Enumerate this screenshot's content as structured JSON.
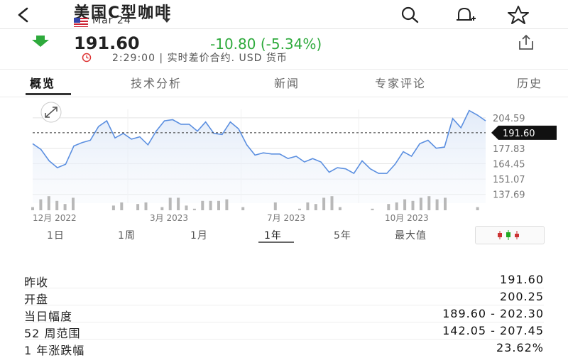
{
  "header": {
    "title": "美国C型咖啡",
    "subtitle": "Mar 24"
  },
  "quote": {
    "price": "191.60",
    "change": "-10.80 (-5.34%)",
    "status": "2:29:00 | 实时差价合约.  USD 货币",
    "change_color": "#2eaa3c"
  },
  "tabs": [
    {
      "label": "概览"
    },
    {
      "label": "技术分析"
    },
    {
      "label": "新闻"
    },
    {
      "label": "专家评论"
    },
    {
      "label": "历史"
    }
  ],
  "chart_data": {
    "type": "line",
    "y_ticks": [
      "204.59",
      "191.60",
      "177.83",
      "164.45",
      "151.07",
      "137.69"
    ],
    "current_label": "191.60",
    "x_ticks": [
      "12月 2022",
      "3月 2023",
      "7月 2023",
      "10月 2023"
    ],
    "ylim": [
      130,
      212
    ],
    "series": [
      {
        "values": [
          182,
          177,
          167,
          161,
          164,
          180,
          183,
          185,
          197,
          202,
          187,
          191,
          186,
          188,
          181,
          193,
          202,
          203,
          199,
          199,
          193,
          201,
          191,
          190,
          201,
          195,
          181,
          172,
          174,
          173,
          173,
          169,
          171,
          166,
          169,
          166,
          157,
          161,
          160,
          156,
          167,
          160,
          156,
          156,
          164,
          175,
          171,
          182,
          185,
          178,
          179,
          204,
          196,
          211,
          207,
          202
        ]
      }
    ],
    "volume": [
      2,
      7,
      9,
      6,
      4,
      8,
      0,
      0,
      0,
      0,
      3,
      5,
      0,
      4,
      5,
      0,
      2,
      8,
      8,
      3,
      1,
      6,
      6,
      6,
      7,
      0,
      2,
      0,
      0,
      0,
      5,
      0,
      0,
      1,
      5,
      4,
      8,
      9,
      2,
      0,
      0,
      0,
      1,
      0,
      4,
      5,
      7,
      6,
      8,
      9,
      7,
      8,
      0,
      0,
      0,
      2,
      0
    ],
    "grid": true,
    "line_color": "#5b8fe0"
  },
  "ranges": [
    {
      "label": "1日"
    },
    {
      "label": "1周"
    },
    {
      "label": "1月"
    },
    {
      "label": "1年"
    },
    {
      "label": "5年"
    },
    {
      "label": "最大值"
    }
  ],
  "stats": [
    {
      "label": "昨收",
      "value": "191.60"
    },
    {
      "label": "开盘",
      "value": "200.25"
    },
    {
      "label": "当日幅度",
      "value": "189.60 - 202.30"
    },
    {
      "label": "52 周范围",
      "value": "142.05 - 207.45"
    },
    {
      "label": "1 年涨跌幅",
      "value": "23.62%"
    }
  ],
  "icons": {
    "back": "chevron-left-icon",
    "search": "search-icon",
    "alert": "bell-plus-icon",
    "watchlist": "star-icon",
    "share": "share-icon"
  }
}
